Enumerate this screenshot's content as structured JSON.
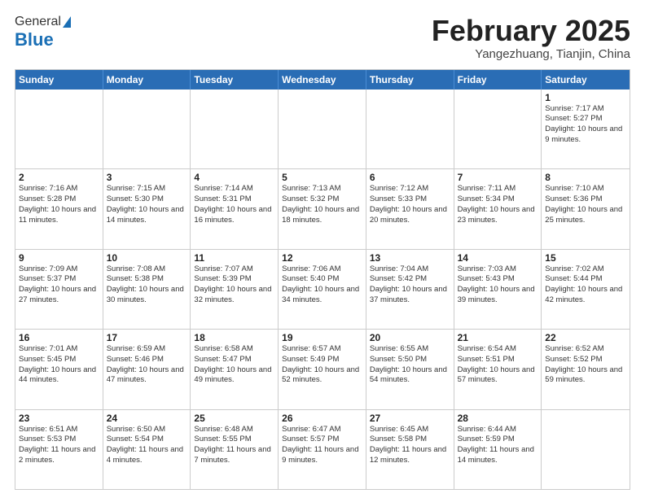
{
  "header": {
    "logo_general": "General",
    "logo_blue": "Blue",
    "title": "February 2025",
    "subtitle": "Yangezhuang, Tianjin, China"
  },
  "days_of_week": [
    "Sunday",
    "Monday",
    "Tuesday",
    "Wednesday",
    "Thursday",
    "Friday",
    "Saturday"
  ],
  "weeks": [
    [
      {
        "day": "",
        "info": ""
      },
      {
        "day": "",
        "info": ""
      },
      {
        "day": "",
        "info": ""
      },
      {
        "day": "",
        "info": ""
      },
      {
        "day": "",
        "info": ""
      },
      {
        "day": "",
        "info": ""
      },
      {
        "day": "1",
        "info": "Sunrise: 7:17 AM\nSunset: 5:27 PM\nDaylight: 10 hours and 9 minutes."
      }
    ],
    [
      {
        "day": "2",
        "info": "Sunrise: 7:16 AM\nSunset: 5:28 PM\nDaylight: 10 hours and 11 minutes."
      },
      {
        "day": "3",
        "info": "Sunrise: 7:15 AM\nSunset: 5:30 PM\nDaylight: 10 hours and 14 minutes."
      },
      {
        "day": "4",
        "info": "Sunrise: 7:14 AM\nSunset: 5:31 PM\nDaylight: 10 hours and 16 minutes."
      },
      {
        "day": "5",
        "info": "Sunrise: 7:13 AM\nSunset: 5:32 PM\nDaylight: 10 hours and 18 minutes."
      },
      {
        "day": "6",
        "info": "Sunrise: 7:12 AM\nSunset: 5:33 PM\nDaylight: 10 hours and 20 minutes."
      },
      {
        "day": "7",
        "info": "Sunrise: 7:11 AM\nSunset: 5:34 PM\nDaylight: 10 hours and 23 minutes."
      },
      {
        "day": "8",
        "info": "Sunrise: 7:10 AM\nSunset: 5:36 PM\nDaylight: 10 hours and 25 minutes."
      }
    ],
    [
      {
        "day": "9",
        "info": "Sunrise: 7:09 AM\nSunset: 5:37 PM\nDaylight: 10 hours and 27 minutes."
      },
      {
        "day": "10",
        "info": "Sunrise: 7:08 AM\nSunset: 5:38 PM\nDaylight: 10 hours and 30 minutes."
      },
      {
        "day": "11",
        "info": "Sunrise: 7:07 AM\nSunset: 5:39 PM\nDaylight: 10 hours and 32 minutes."
      },
      {
        "day": "12",
        "info": "Sunrise: 7:06 AM\nSunset: 5:40 PM\nDaylight: 10 hours and 34 minutes."
      },
      {
        "day": "13",
        "info": "Sunrise: 7:04 AM\nSunset: 5:42 PM\nDaylight: 10 hours and 37 minutes."
      },
      {
        "day": "14",
        "info": "Sunrise: 7:03 AM\nSunset: 5:43 PM\nDaylight: 10 hours and 39 minutes."
      },
      {
        "day": "15",
        "info": "Sunrise: 7:02 AM\nSunset: 5:44 PM\nDaylight: 10 hours and 42 minutes."
      }
    ],
    [
      {
        "day": "16",
        "info": "Sunrise: 7:01 AM\nSunset: 5:45 PM\nDaylight: 10 hours and 44 minutes."
      },
      {
        "day": "17",
        "info": "Sunrise: 6:59 AM\nSunset: 5:46 PM\nDaylight: 10 hours and 47 minutes."
      },
      {
        "day": "18",
        "info": "Sunrise: 6:58 AM\nSunset: 5:47 PM\nDaylight: 10 hours and 49 minutes."
      },
      {
        "day": "19",
        "info": "Sunrise: 6:57 AM\nSunset: 5:49 PM\nDaylight: 10 hours and 52 minutes."
      },
      {
        "day": "20",
        "info": "Sunrise: 6:55 AM\nSunset: 5:50 PM\nDaylight: 10 hours and 54 minutes."
      },
      {
        "day": "21",
        "info": "Sunrise: 6:54 AM\nSunset: 5:51 PM\nDaylight: 10 hours and 57 minutes."
      },
      {
        "day": "22",
        "info": "Sunrise: 6:52 AM\nSunset: 5:52 PM\nDaylight: 10 hours and 59 minutes."
      }
    ],
    [
      {
        "day": "23",
        "info": "Sunrise: 6:51 AM\nSunset: 5:53 PM\nDaylight: 11 hours and 2 minutes."
      },
      {
        "day": "24",
        "info": "Sunrise: 6:50 AM\nSunset: 5:54 PM\nDaylight: 11 hours and 4 minutes."
      },
      {
        "day": "25",
        "info": "Sunrise: 6:48 AM\nSunset: 5:55 PM\nDaylight: 11 hours and 7 minutes."
      },
      {
        "day": "26",
        "info": "Sunrise: 6:47 AM\nSunset: 5:57 PM\nDaylight: 11 hours and 9 minutes."
      },
      {
        "day": "27",
        "info": "Sunrise: 6:45 AM\nSunset: 5:58 PM\nDaylight: 11 hours and 12 minutes."
      },
      {
        "day": "28",
        "info": "Sunrise: 6:44 AM\nSunset: 5:59 PM\nDaylight: 11 hours and 14 minutes."
      },
      {
        "day": "",
        "info": ""
      }
    ]
  ]
}
